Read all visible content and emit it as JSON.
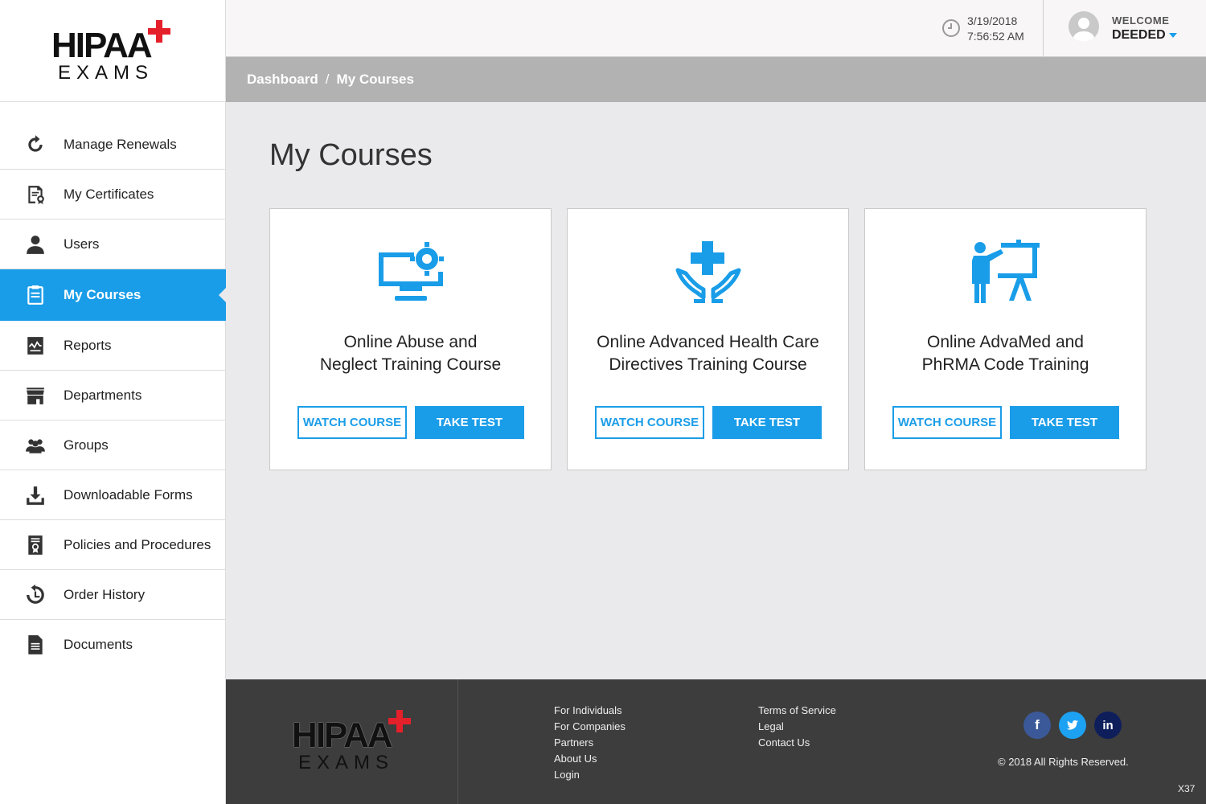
{
  "brand": {
    "logo_word": "HIPAA",
    "logo_sub": "EXAMS"
  },
  "header": {
    "date": "3/19/2018",
    "time": "7:56:52 AM",
    "welcome": "WELCOME",
    "username": "DEEDED"
  },
  "breadcrumb": {
    "home": "Dashboard",
    "separator": "/",
    "current": "My Courses"
  },
  "sidebar": {
    "items": [
      {
        "label": "Manage Renewals",
        "icon": "refresh-icon"
      },
      {
        "label": "My Certificates",
        "icon": "certificate-icon"
      },
      {
        "label": "Users",
        "icon": "user-icon"
      },
      {
        "label": "My Courses",
        "icon": "clipboard-icon",
        "active": true
      },
      {
        "label": "Reports",
        "icon": "report-icon"
      },
      {
        "label": "Departments",
        "icon": "store-icon"
      },
      {
        "label": "Groups",
        "icon": "group-icon"
      },
      {
        "label": "Downloadable Forms",
        "icon": "download-icon"
      },
      {
        "label": "Policies and Procedures",
        "icon": "policy-icon"
      },
      {
        "label": "Order History",
        "icon": "history-icon"
      },
      {
        "label": "Documents",
        "icon": "document-icon"
      }
    ]
  },
  "main": {
    "title": "My Courses",
    "courses": [
      {
        "line1": "Online Abuse and",
        "line2": "Neglect Training Course",
        "icon": "monitor-gear-icon",
        "watch": "WATCH COURSE",
        "test": "TAKE TEST"
      },
      {
        "line1": "Online Advanced Health Care",
        "line2": "Directives Training Course",
        "icon": "hands-cross-icon",
        "watch": "WATCH COURSE",
        "test": "TAKE TEST"
      },
      {
        "line1": "Online AdvaMed and",
        "line2": "PhRMA Code Training",
        "icon": "presenter-board-icon",
        "watch": "WATCH COURSE",
        "test": "TAKE TEST"
      }
    ]
  },
  "footer": {
    "col1": [
      "For Individuals",
      "For Companies",
      "Partners",
      "About Us",
      "Login"
    ],
    "col2": [
      "Terms of Service",
      "Legal",
      "Contact Us"
    ],
    "social": {
      "facebook": "f",
      "twitter": "t",
      "linkedin": "in"
    },
    "copyright": "© 2018 All Rights Reserved.",
    "code": "X37"
  },
  "colors": {
    "accent": "#1a9de8",
    "brand_red": "#e4202b",
    "footer_bg": "#3d3d3d",
    "facebook": "#3b5998",
    "twitter": "#1da1f2",
    "linkedin": "#0e1e5b"
  }
}
